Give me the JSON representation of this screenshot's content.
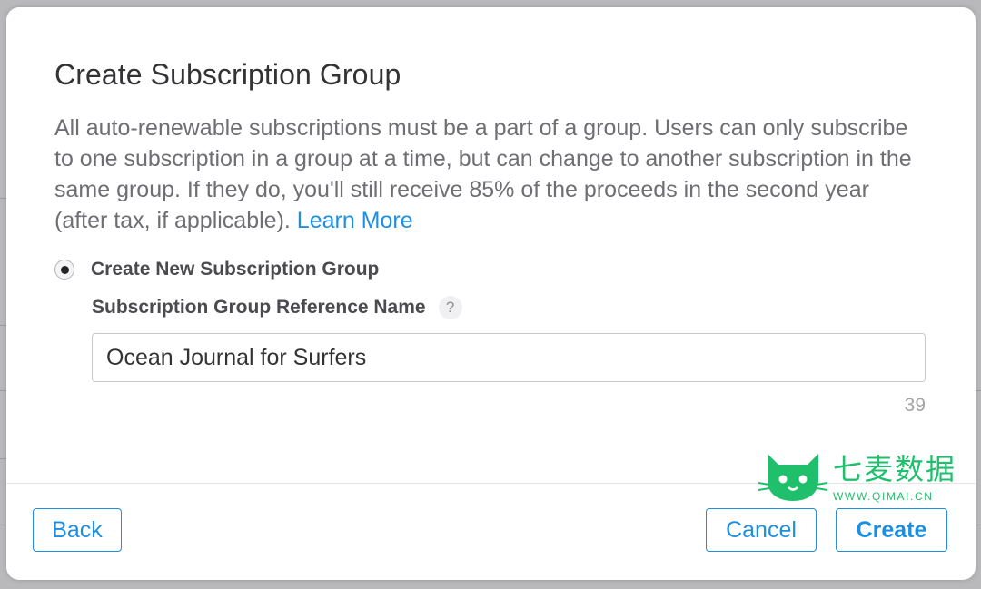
{
  "dialog": {
    "title": "Create Subscription Group",
    "description": "All auto-renewable subscriptions must be a part of a group. Users can only subscribe to one subscription in a group at a time, but can change to another subscription in the same group. If they do, you'll still receive 85% of the proceeds in the second year (after tax, if applicable). ",
    "learn_more": "Learn More",
    "radio_label": "Create New Subscription Group",
    "radio_selected": true,
    "field_label": "Subscription Group Reference Name",
    "help_glyph": "?",
    "input_value": "Ocean Journal for Surfers",
    "char_counter": "39",
    "buttons": {
      "back": "Back",
      "cancel": "Cancel",
      "create": "Create"
    }
  },
  "watermark": {
    "name": "七麦数据",
    "url": "WWW.QIMAI.CN",
    "icon": "cat-logo-icon"
  },
  "colors": {
    "accent": "#1d8fe1",
    "watermark": "#1fbf6c",
    "text": "#333336",
    "muted": "#6e6e73"
  }
}
